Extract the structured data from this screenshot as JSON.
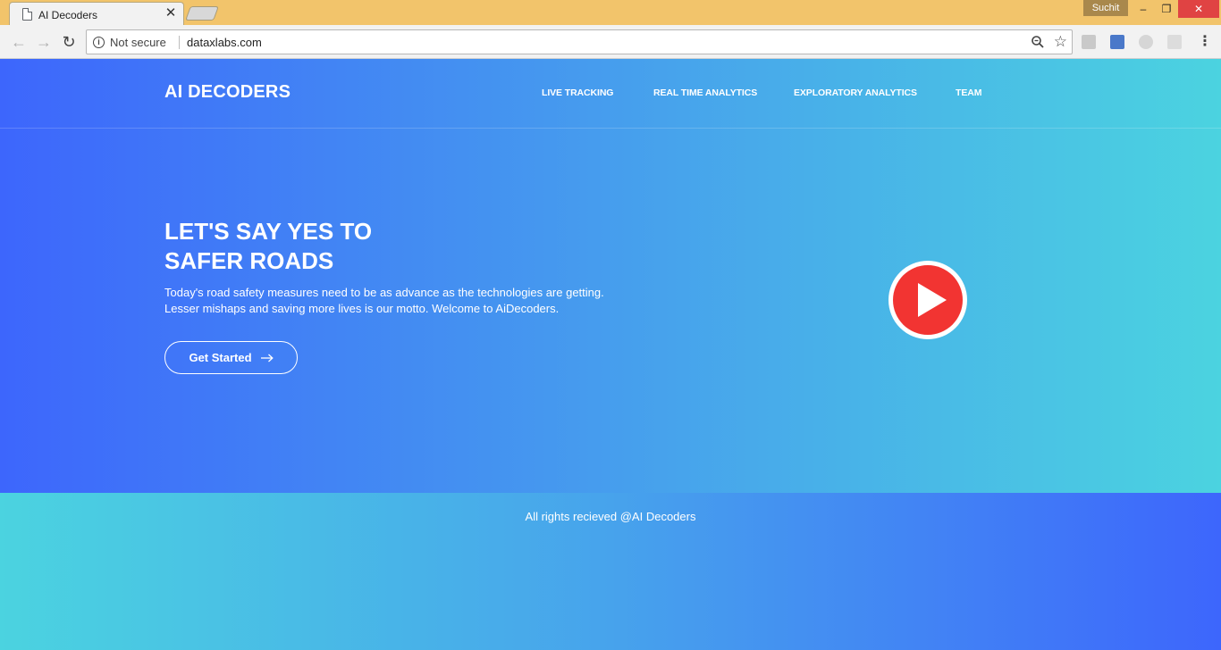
{
  "browser": {
    "tab_title": "AI Decoders",
    "profile_name": "Suchit",
    "security_label": "Not secure",
    "url": "dataxlabs.com"
  },
  "site": {
    "brand": "AI DECODERS",
    "nav": [
      {
        "label": "LIVE TRACKING"
      },
      {
        "label": "REAL TIME ANALYTICS"
      },
      {
        "label": "EXPLORATORY ANALYTICS"
      },
      {
        "label": "TEAM"
      }
    ],
    "hero": {
      "title_line1": "LET'S SAY YES TO",
      "title_line2": "SAFER ROADS",
      "desc_line1": "Today's road safety measures need to be as advance as the technologies are getting.",
      "desc_line2": "Lesser mishaps and saving more lives is our motto. Welcome to AiDecoders.",
      "cta_label": "Get Started"
    },
    "footer": {
      "copyright": "All rights recieved @AI Decoders"
    }
  },
  "colors": {
    "gradient_blue": "#3d66fc",
    "gradient_cyan": "#4bd3e0",
    "play_red": "#f23432",
    "titlebar": "#f2c46b"
  }
}
